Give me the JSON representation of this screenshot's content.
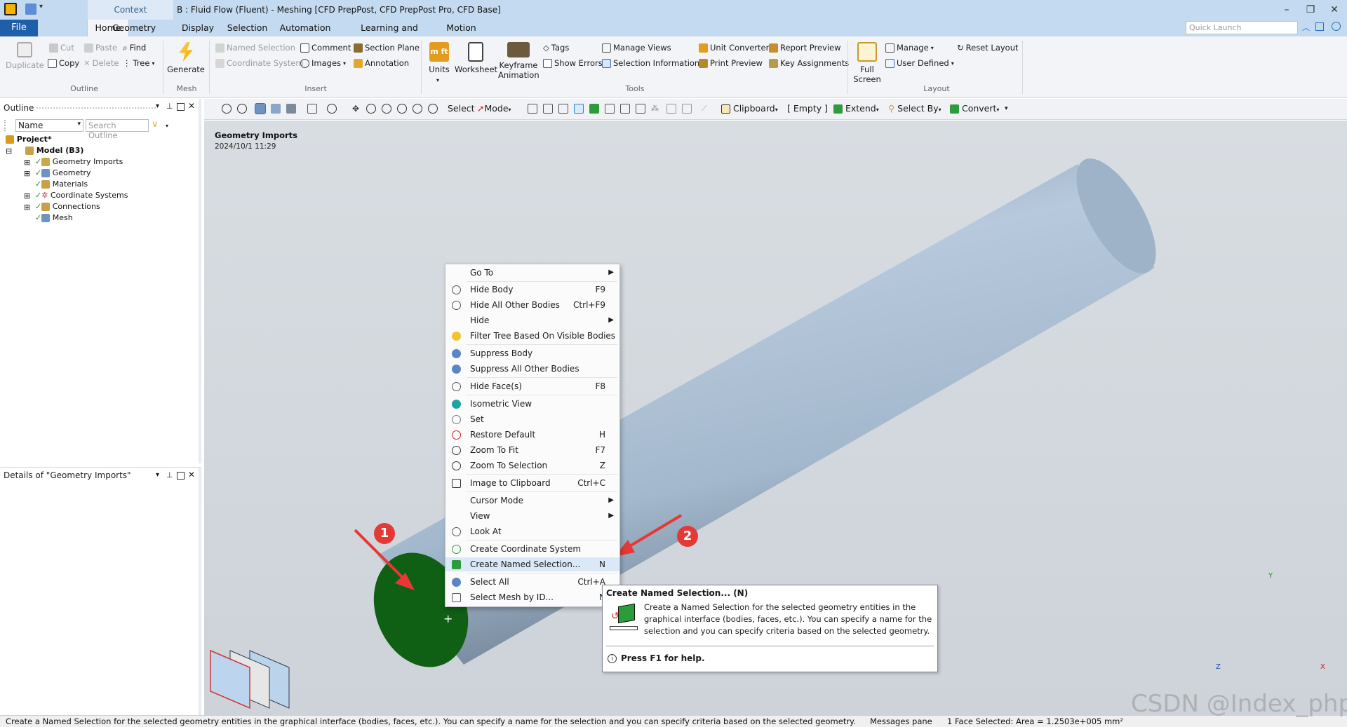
{
  "title_bar": {
    "context_tab": "Context",
    "window_title": "B : Fluid Flow (Fluent) - Meshing [CFD PrepPost, CFD PrepPost Pro, CFD Base]",
    "minimize": "–",
    "restore": "❐",
    "close": "✕"
  },
  "menu": {
    "file": "File",
    "tabs": [
      "Home",
      "Geometry Imports",
      "Display",
      "Selection",
      "Automation",
      "Learning and Support",
      "Motion"
    ],
    "quick_launch_placeholder": "Quick Launch"
  },
  "ribbon": {
    "outline": {
      "label": "Outline",
      "duplicate": "Duplicate",
      "cut": "Cut",
      "copy": "Copy",
      "paste": "Paste",
      "delete": "Delete",
      "find": "Find",
      "tree": "Tree"
    },
    "mesh": {
      "label": "Mesh",
      "generate": "Generate"
    },
    "insert": {
      "label": "Insert",
      "named_selection": "Named Selection",
      "coordinate_system": "Coordinate System",
      "comment": "Comment",
      "images": "Images",
      "section_plane": "Section Plane",
      "annotation": "Annotation"
    },
    "tools": {
      "label": "Tools",
      "units": "Units",
      "worksheet": "Worksheet",
      "keyframe_1": "Keyframe",
      "keyframe_2": "Animation",
      "tags": "Tags",
      "show_errors": "Show Errors",
      "manage_views": "Manage Views",
      "selection_information": "Selection Information",
      "unit_converter": "Unit Converter",
      "print_preview": "Print Preview",
      "report_preview": "Report Preview",
      "key_assignments": "Key Assignments"
    },
    "layout": {
      "label": "Layout",
      "full_1": "Full",
      "full_2": "Screen",
      "manage": "Manage",
      "user_defined": "User Defined",
      "reset_layout": "Reset Layout"
    }
  },
  "graphics_toolbar": {
    "select": "Select",
    "mode": "Mode",
    "clipboard": "Clipboard",
    "empty": "[ Empty ]",
    "extend": "Extend",
    "select_by": "Select By",
    "convert": "Convert"
  },
  "outline_pane": {
    "title": "Outline",
    "filter": "Name",
    "search_placeholder": "Search Outline",
    "tree": [
      "Project*",
      "Model (B3)",
      "Geometry Imports",
      "Geometry",
      "Materials",
      "Coordinate Systems",
      "Connections",
      "Mesh"
    ]
  },
  "details_pane": {
    "title": "Details of \"Geometry Imports\""
  },
  "viewport": {
    "title": "Geometry Imports",
    "date": "2024/10/1 11:29",
    "axis_y": "Y",
    "axis_z": "Z",
    "axis_x": "X",
    "badge_1": "1",
    "badge_2": "2",
    "watermark": "CSDN @Index_php"
  },
  "context_menu": {
    "items": [
      {
        "label": "Go To",
        "shortcut": ""
      },
      {
        "label": "Hide Body",
        "shortcut": "F9"
      },
      {
        "label": "Hide All Other Bodies",
        "shortcut": "Ctrl+F9"
      },
      {
        "label": "Hide",
        "shortcut": ""
      },
      {
        "label": "Filter Tree Based On Visible Bodies",
        "shortcut": ""
      },
      {
        "label": "Suppress Body",
        "shortcut": ""
      },
      {
        "label": "Suppress All Other Bodies",
        "shortcut": ""
      },
      {
        "label": "Hide Face(s)",
        "shortcut": "F8"
      },
      {
        "label": "Isometric View",
        "shortcut": ""
      },
      {
        "label": "Set",
        "shortcut": ""
      },
      {
        "label": "Restore Default",
        "shortcut": "H"
      },
      {
        "label": "Zoom To Fit",
        "shortcut": "F7"
      },
      {
        "label": "Zoom To Selection",
        "shortcut": "Z"
      },
      {
        "label": "Image to Clipboard",
        "shortcut": "Ctrl+C"
      },
      {
        "label": "Cursor Mode",
        "shortcut": ""
      },
      {
        "label": "View",
        "shortcut": ""
      },
      {
        "label": "Look At",
        "shortcut": ""
      },
      {
        "label": "Create Coordinate System",
        "shortcut": ""
      },
      {
        "label": "Create Named Selection...",
        "shortcut": "N"
      },
      {
        "label": "Select All",
        "shortcut": "Ctrl+A"
      },
      {
        "label": "Select Mesh by ID...",
        "shortcut": "N"
      }
    ]
  },
  "tooltip": {
    "title": "Create Named Selection... (N)",
    "line1": "Create a Named Selection for the selected geometry entities in the",
    "line2": "graphical interface (bodies, faces, etc.). You can specify a name for the",
    "line3": "selection and you can specify criteria based on the selected geometry.",
    "help": "Press F1 for help."
  },
  "status_bar": {
    "message": "Create a Named Selection for the selected geometry entities in the graphical interface (bodies, faces, etc.). You can specify a name for the selection and you can specify criteria based on the selected geometry.",
    "messages_pane": "Messages pane",
    "selection": "1 Face Selected: Area = 1.2503e+005 mm²"
  },
  "colors": {
    "title_bar": "#c3daf0",
    "file_tab": "#1f5faa",
    "selected_face": "#0f5f14",
    "cylinder": "#a9bdd1",
    "annotation_red": "#e53935",
    "menu_highlight": "#dbe8f7"
  }
}
